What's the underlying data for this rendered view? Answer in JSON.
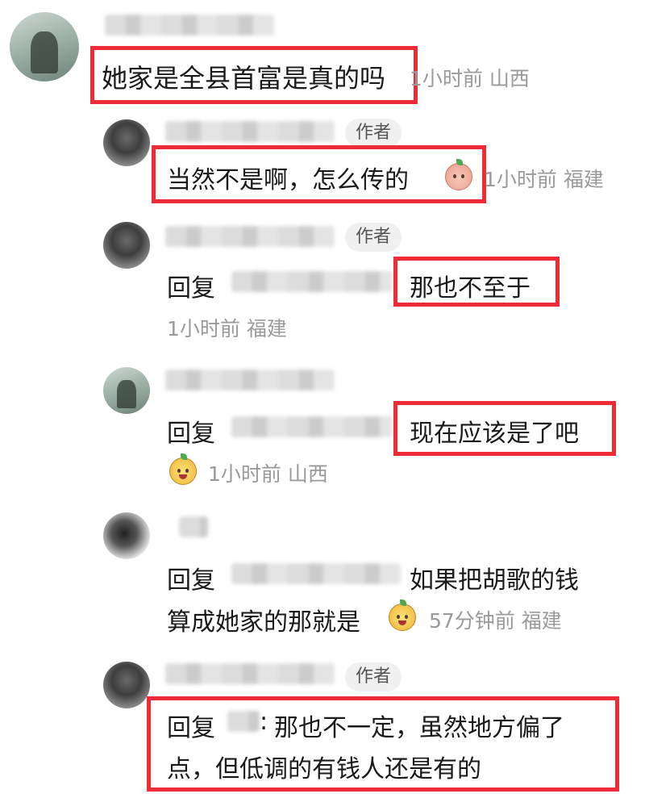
{
  "colors": {
    "highlight": "#ee2b36",
    "meta": "#9a9a9a",
    "badge_bg": "#f0f0f0"
  },
  "comments": [
    {
      "text": "她家是全县首富是真的吗",
      "meta": "1小时前 山西"
    },
    {
      "badge": "作者",
      "text": "当然不是啊，怎么传的",
      "emoji": "peach-face-icon",
      "meta": "1小时前 福建"
    },
    {
      "badge": "作者",
      "reply_prefix": "回复",
      "text": "那也不至于",
      "meta": "1小时前 福建"
    },
    {
      "reply_prefix": "回复",
      "text": "现在应该是了吧",
      "emoji": "bear-face-icon",
      "meta": "1小时前 山西"
    },
    {
      "reply_prefix": "回复",
      "text_line1": "如果把胡歌的钱",
      "text_line2": "算成她家的那就是",
      "emoji": "bear-face-icon",
      "meta": "57分钟前 福建"
    },
    {
      "badge": "作者",
      "reply_prefix": "回复",
      "reply_sep": ": ",
      "text_line1": "那也不一定，虽然地方偏了",
      "text_line2": "点，但低调的有钱人还是有的"
    }
  ]
}
